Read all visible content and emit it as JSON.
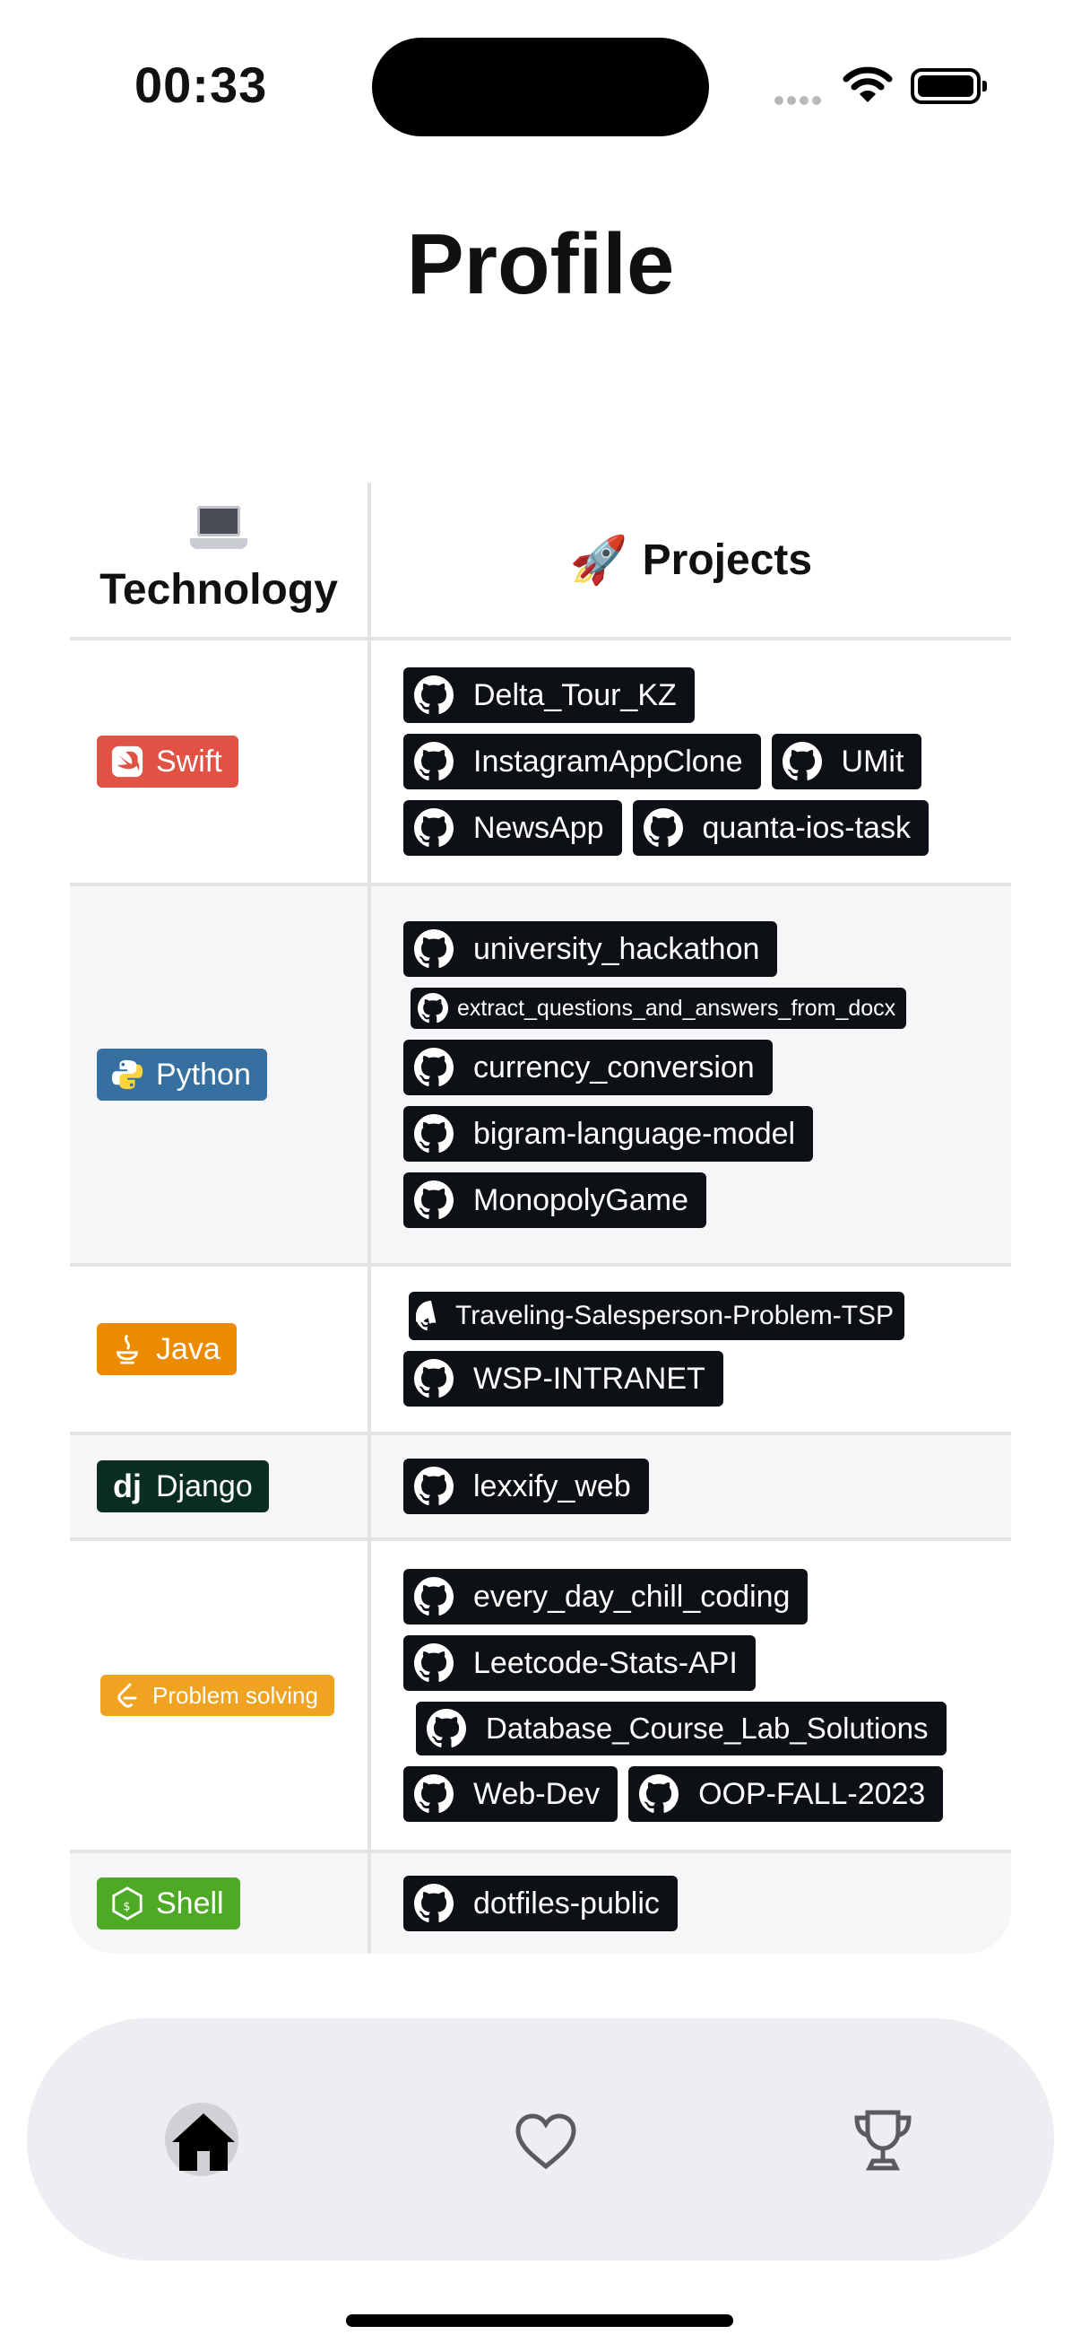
{
  "status": {
    "time": "00:33"
  },
  "title": "Profile",
  "table": {
    "tech_header": "Technology",
    "proj_header": "Projects",
    "rows": [
      {
        "tech": {
          "label": "Swift",
          "color": "#e05243",
          "icon": "swift-icon"
        },
        "projects": [
          [
            "Delta_Tour_KZ"
          ],
          [
            "InstagramAppClone",
            "UMit"
          ],
          [
            "NewsApp",
            "quanta-ios-task"
          ]
        ]
      },
      {
        "tech": {
          "label": "Python",
          "color": "#3670a0",
          "icon": "python-icon"
        },
        "projects": [
          [
            "university_hackathon"
          ],
          [
            "extract_questions_and_answers_from_docx"
          ],
          [
            "currency_conversion"
          ],
          [
            "bigram-language-model"
          ],
          [
            "MonopolyGame"
          ]
        ]
      },
      {
        "tech": {
          "label": "Java",
          "color": "#ed8b00",
          "icon": "java-icon"
        },
        "projects": [
          [
            "Traveling-Salesperson-Problem-TSP"
          ],
          [
            "WSP-INTRANET"
          ]
        ]
      },
      {
        "tech": {
          "label": "Django",
          "color": "#092e20",
          "icon": "django-icon"
        },
        "projects": [
          [
            "lexxify_web"
          ]
        ]
      },
      {
        "tech": {
          "label": "Problem solving",
          "color": "#f0a221",
          "icon": "leetcode-icon"
        },
        "projects": [
          [
            "every_day_chill_coding"
          ],
          [
            "Leetcode-Stats-API"
          ],
          [
            "Database_Course_Lab_Solutions"
          ],
          [
            "Web-Dev",
            "OOP-FALL-2023"
          ]
        ]
      },
      {
        "tech": {
          "label": "Shell",
          "color": "#4eaa25",
          "icon": "shell-icon"
        },
        "projects": [
          [
            "dotfiles-public"
          ]
        ]
      }
    ]
  },
  "tabbar": {
    "items": [
      "home-icon",
      "heart-icon",
      "trophy-icon"
    ],
    "selected": "home"
  }
}
